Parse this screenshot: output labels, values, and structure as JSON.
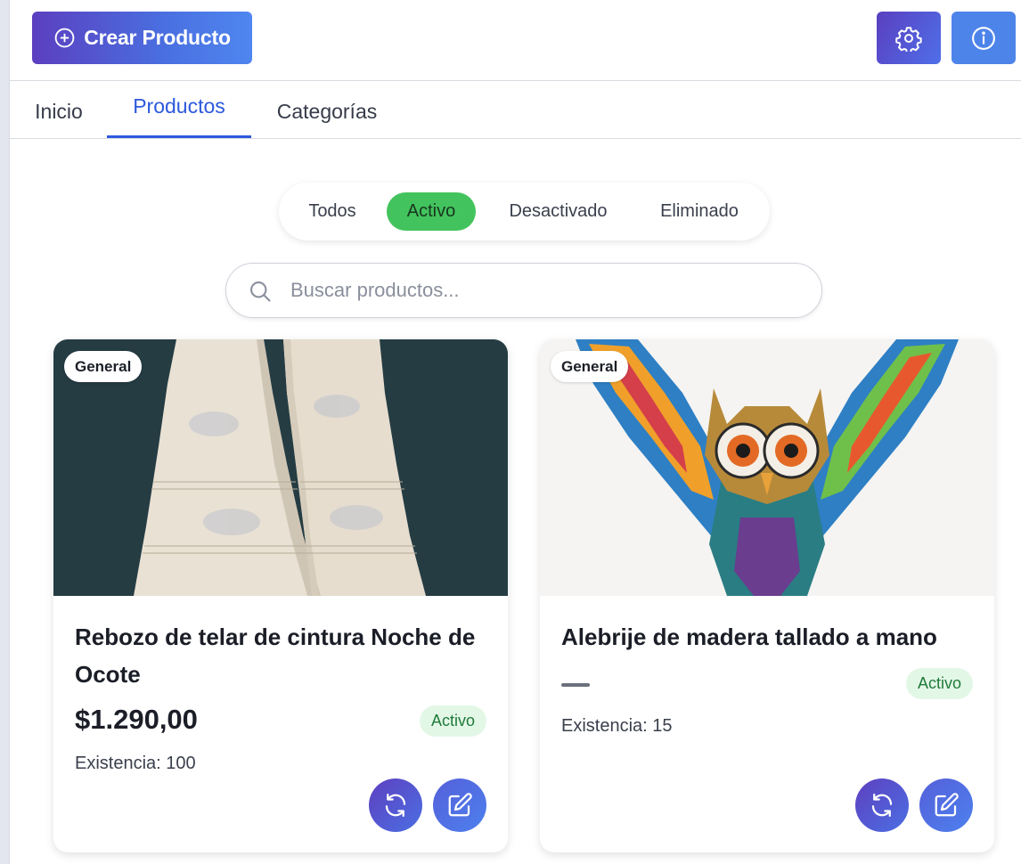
{
  "header": {
    "create_label": "Crear Producto",
    "create_icon": "plus-circle-icon",
    "settings_icon": "gear-icon",
    "info_icon": "info-icon",
    "accent_gradient": [
      "#5b3fc0",
      "#4f86f0"
    ]
  },
  "tabs": [
    {
      "label": "Inicio",
      "active": false
    },
    {
      "label": "Productos",
      "active": true
    },
    {
      "label": "Categorías",
      "active": false
    }
  ],
  "filters": [
    {
      "label": "Todos",
      "active": false
    },
    {
      "label": "Activo",
      "active": true
    },
    {
      "label": "Desactivado",
      "active": false
    },
    {
      "label": "Eliminado",
      "active": false
    }
  ],
  "search": {
    "placeholder": "Buscar productos...",
    "value": ""
  },
  "products": [
    {
      "category": "General",
      "name": "Rebozo de telar de cintura Noche de Ocote",
      "price": "$1.290,00",
      "status": "Activo",
      "stock": "Existencia: 100",
      "image": "woven-shawl-image"
    },
    {
      "category": "General",
      "name": "Alebrije de madera tallado a mano",
      "price": "",
      "status": "Activo",
      "stock": "Existencia: 15",
      "image": "alebrije-owl-image"
    }
  ],
  "colors": {
    "active_tab": "#2c59dc",
    "active_filter": "#43c35d",
    "status_bg": "#e3f7e7",
    "status_text": "#1f7a3a"
  }
}
